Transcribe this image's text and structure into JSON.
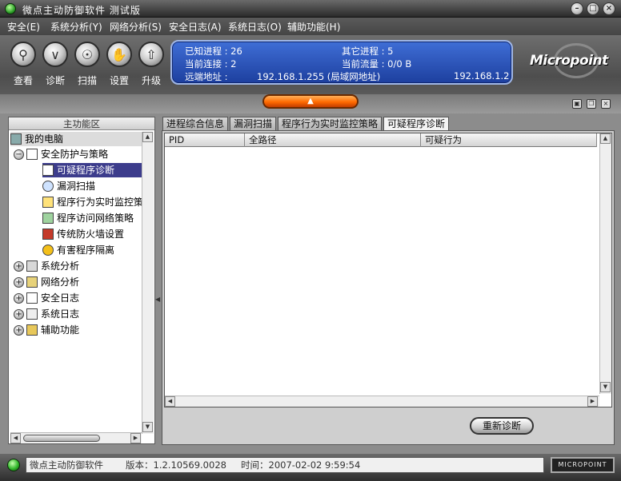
{
  "window": {
    "title": "微点主动防御软件  测试版"
  },
  "menu": [
    "安全(E)",
    "系统分析(Y)",
    "网络分析(S)",
    "安全日志(A)",
    "系统日志(O)",
    "辅助功能(H)"
  ],
  "toolbar": {
    "buttons": [
      {
        "label": "查看",
        "icon": "magnifier-icon"
      },
      {
        "label": "诊断",
        "icon": "chevron-icon"
      },
      {
        "label": "扫描",
        "icon": "shield-icon"
      },
      {
        "label": "设置",
        "icon": "hand-icon"
      },
      {
        "label": "升级",
        "icon": "up-arrow-icon"
      }
    ]
  },
  "info": {
    "known_proc_label": "已知进程 : 26",
    "other_proc_label": "其它进程 : 5",
    "conn_label": "当前连接 : 2",
    "traffic_label": "当前流量 : 0/0 B",
    "remote_label": "远端地址 :",
    "remote_value": "192.168.1.255 (局域网地址)",
    "remote_value2": "192.168.1.2"
  },
  "brand": {
    "text": "Micropoint"
  },
  "left_panel": {
    "header": "主功能区",
    "root": "我的电脑",
    "security": "安全防护与策略",
    "children": [
      "可疑程序诊断",
      "漏洞扫描",
      "程序行为实时监控策",
      "程序访问网络策略",
      "传统防火墙设置",
      "有害程序隔离"
    ],
    "groups": [
      "系统分析",
      "网络分析",
      "安全日志",
      "系统日志",
      "辅助功能"
    ]
  },
  "tabs": [
    "进程综合信息",
    "漏洞扫描",
    "程序行为实时监控策略",
    "可疑程序诊断"
  ],
  "list": {
    "columns": [
      "PID",
      "全路径",
      "可疑行为"
    ]
  },
  "rediagnose_label": "重新诊断",
  "status": {
    "app": "微点主动防御软件",
    "version": "版本：1.2.10569.0028",
    "time": "时间：2007-02-02 9:59:54",
    "logo": "MICROPOINT"
  },
  "colors": {
    "accent": "#2d55c0",
    "selected": "#3c3c8c",
    "orange": "#ff6a00"
  }
}
